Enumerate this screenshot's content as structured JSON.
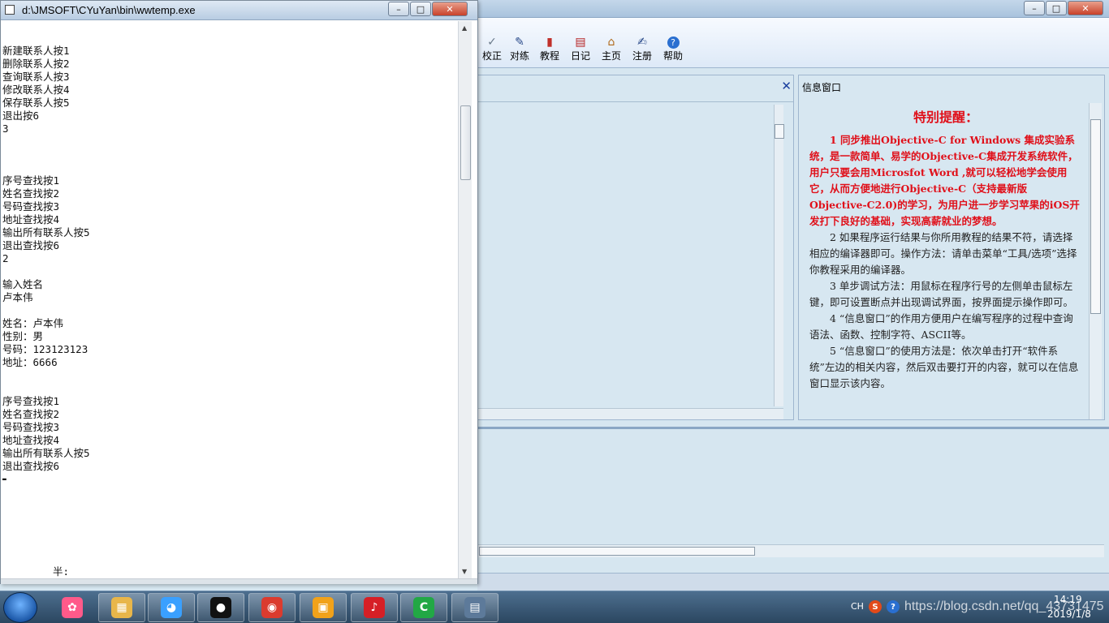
{
  "console": {
    "title": "d:\\JMSOFT\\CYuYan\\bin\\wwtemp.exe",
    "lines": [
      "新建联系人按1",
      "删除联系人按2",
      "查询联系人按3",
      "修改联系人按4",
      "保存联系人按5",
      "退出按6",
      "3",
      "",
      "",
      "",
      "序号查找按1",
      "姓名查找按2",
      "号码查找按3",
      "地址查找按4",
      "输出所有联系人按5",
      "退出查找按6",
      "2",
      "",
      "输入姓名",
      "卢本伟",
      "",
      "姓名：卢本伟",
      "性别：男",
      "号码：123123123",
      "地址：6666",
      "",
      "",
      "序号查找按1",
      "姓名查找按2",
      "号码查找按3",
      "地址查找按4",
      "输出所有联系人按5",
      "退出查找按6"
    ],
    "cursor": "▬",
    "bottom_text": "半:"
  },
  "ide": {
    "toolbar": [
      {
        "icon": "✓",
        "label": "校正"
      },
      {
        "icon": "✎",
        "label": "对练"
      },
      {
        "icon": "▮",
        "label": "教程"
      },
      {
        "icon": "▤",
        "label": "日记"
      },
      {
        "icon": "⌂",
        "label": "主页"
      },
      {
        "icon": "✍",
        "label": "注册"
      },
      {
        "icon": "?",
        "label": "帮助"
      }
    ],
    "editor_close": "✕",
    "info_window": {
      "title": "信息窗口",
      "heading": "特别提醒：",
      "tips": [
        "1 同步推出Objective-C for Windows 集成实验系统，是一款简单、易学的Objective-C集成开发系统软件，用户只要会用Microsfot Word ,就可以轻松地学会使用它，从而方便地进行Objective-C（支持最新版Objective-C2.0)的学习，为用户进一步学习苹果的iOS开发打下良好的基础，实现高薪就业的梦想。",
        "2 如果程序运行结果与你所用教程的结果不符，请选择相应的编译器即可。操作方法：请单击菜单“工具/选项”选择你教程采用的编译器。",
        "3 单步调试方法：用鼠标在程序行号的左侧单击鼠标左键，即可设置断点并出现调试界面，按界面提示操作即可。",
        "4 “信息窗口”的作用方便用户在编写程序的过程中查询语法、函数、控制字符、ASCII等。",
        "5 “信息窗口”的使用方法是：依次单击打开“软件系统”左边的相关内容，然后双击要打开的内容，就可以在信息窗口显示该内容。"
      ]
    }
  },
  "window_controls": {
    "minimize": "–",
    "maximize": "□",
    "close": "✕"
  },
  "taskbar": {
    "apps": [
      {
        "name": "colorful-app",
        "glyph": "✿",
        "color": "#ff5a8a"
      },
      {
        "name": "file-explorer",
        "glyph": "▦",
        "color": "#e8b64a"
      },
      {
        "name": "messenger",
        "glyph": "◕",
        "color": "#3aa0ff"
      },
      {
        "name": "qq",
        "glyph": "●",
        "color": "#111111"
      },
      {
        "name": "chrome",
        "glyph": "◉",
        "color": "#db3b2e"
      },
      {
        "name": "file-manager",
        "glyph": "▣",
        "color": "#f1a21a"
      },
      {
        "name": "netease-music",
        "glyph": "♪",
        "color": "#d61f26"
      },
      {
        "name": "c-language-ide",
        "glyph": "C",
        "color": "#22a845"
      },
      {
        "name": "console-window",
        "glyph": "▤",
        "color": "#5d7a9a"
      }
    ],
    "tray": {
      "language": "CH",
      "url_overlay": "https://blog.csdn.net/qq_43731475",
      "time": "14:19",
      "date": "2019/1/8"
    }
  }
}
